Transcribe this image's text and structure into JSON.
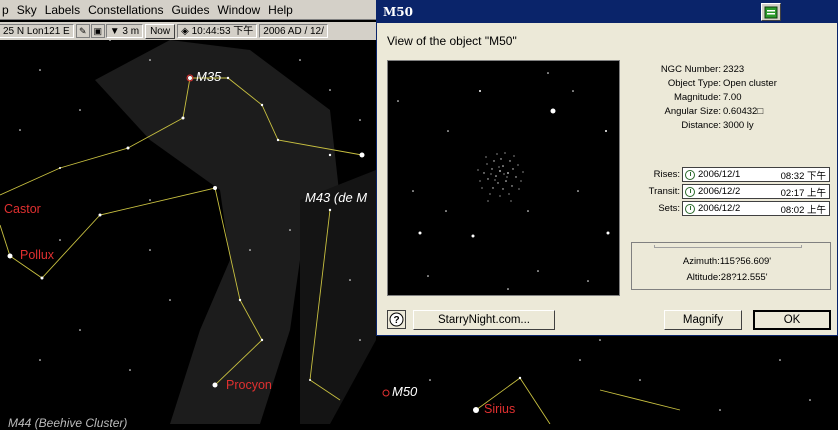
{
  "menu": {
    "partial_first": "p",
    "items": [
      "Sky",
      "Labels",
      "Constellations",
      "Guides",
      "Window",
      "Help"
    ]
  },
  "toolbar": {
    "location": "25 N Lon121 E",
    "time_step": "3 m",
    "now_label": "Now",
    "time": "10:44:53 下午",
    "date": "2006 AD / 12/"
  },
  "sky_labels": {
    "m35": "M35",
    "castor": "Castor",
    "pollux": "Pollux",
    "m43": "M43 (de M",
    "procyon": "Procyon",
    "m50": "M50",
    "sirius": "Sirius",
    "m44": "M44 (Beehive Cluster)"
  },
  "dialog": {
    "title": "M50",
    "heading": "View of the object \"M50\"",
    "info": {
      "ngc_label": "NGC Number:",
      "ngc_value": "2323",
      "type_label": "Object Type:",
      "type_value": "Open cluster",
      "mag_label": "Magnitude:",
      "mag_value": "7.00",
      "size_label": "Angular Size:",
      "size_value": "0.60432□",
      "dist_label": "Distance:",
      "dist_value": "3000 ly"
    },
    "times": {
      "rises_label": "Rises:",
      "rises_date": "2006/12/1",
      "rises_time": "08:32 下午",
      "transit_label": "Transit:",
      "transit_date": "2006/12/2",
      "transit_time": "02:17 上午",
      "sets_label": "Sets:",
      "sets_date": "2006/12/2",
      "sets_time": "08:02 上午"
    },
    "azimuth": "Azimuth:115?56.609'",
    "altitude": "Altitude:28?12.555'",
    "buttons": {
      "website": "StarryNight.com...",
      "magnify": "Magnify",
      "ok": "OK"
    }
  },
  "colors": {
    "title_bar": "#0a246a",
    "dialog_bg": "#ece9d8",
    "star_label_red": "#e03030",
    "constellation_line": "#c8c040"
  }
}
